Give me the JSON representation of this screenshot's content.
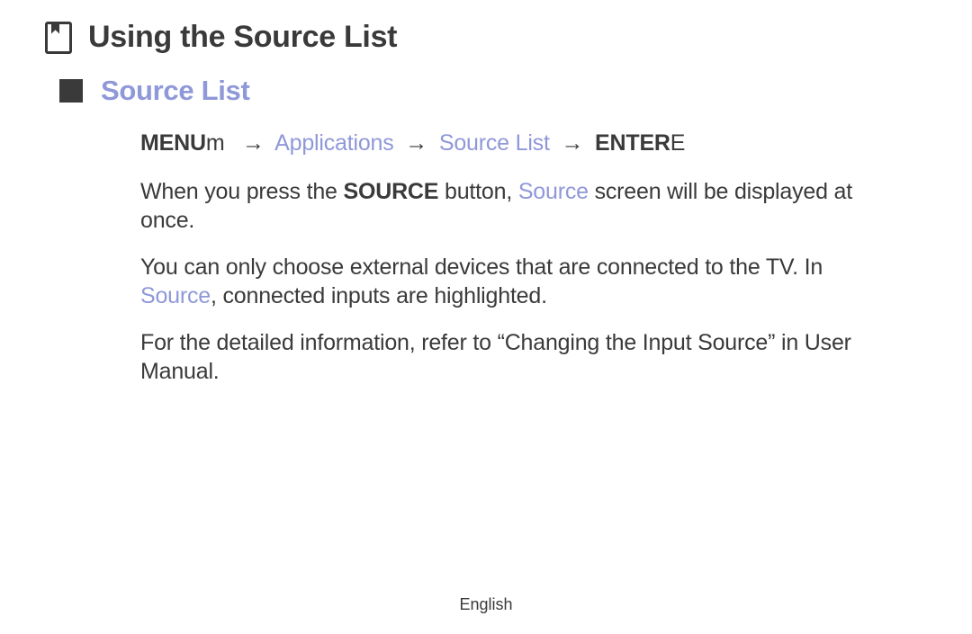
{
  "heading": {
    "title": "Using the Source List",
    "subtitle": "Source List"
  },
  "nav": {
    "menu_bold": "MENU",
    "menu_small": "m",
    "applications": "Applications",
    "source_list": "Source List",
    "enter_bold": "ENTER",
    "enter_tail": "E",
    "arrow": "→"
  },
  "paragraphs": {
    "p1_a": "When you press the ",
    "p1_source_bold": "SOURCE",
    "p1_b": " button, ",
    "p1_source_blue": "Source",
    "p1_c": " screen will be displayed at once.",
    "p2_a": "You can only choose external devices that are connected to the TV. In ",
    "p2_source_blue": "Source",
    "p2_b": ", connected inputs are highlighted.",
    "p3": "For the detailed information, refer to “Changing the Input Source” in User Manual."
  },
  "footer": {
    "language": "English"
  }
}
